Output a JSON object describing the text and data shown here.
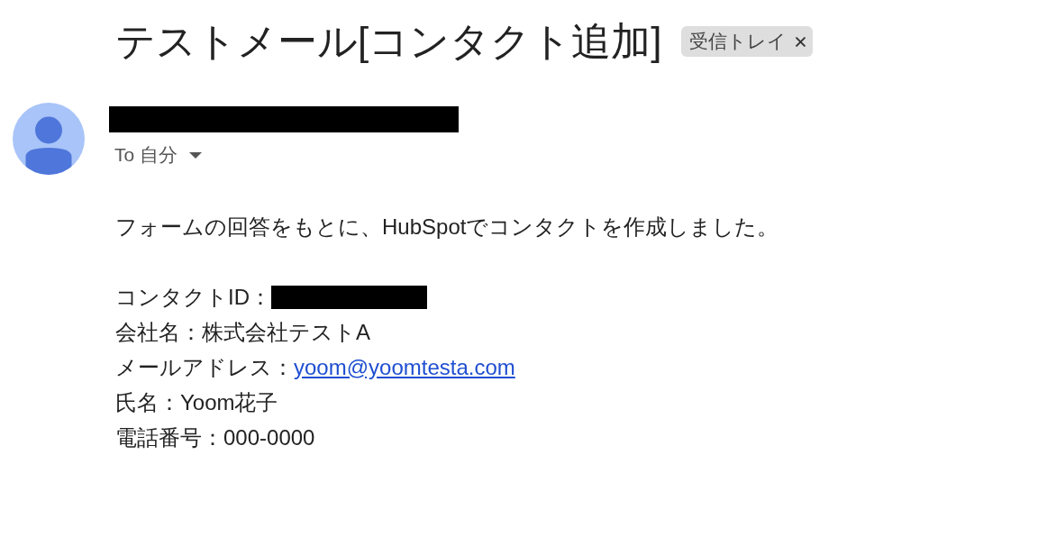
{
  "subject": {
    "title": "テストメール[コンタクト追加]",
    "labels": [
      {
        "text": "受信トレイ"
      }
    ]
  },
  "message": {
    "sender": {
      "redacted": true
    },
    "recipient": "To 自分",
    "body": {
      "intro": "フォームの回答をもとに、HubSpotでコンタクトを作成しました。",
      "fields": [
        {
          "kind": "redacted",
          "label": "コンタクトID："
        },
        {
          "kind": "text",
          "label": "会社名：",
          "value": "株式会社テストA"
        },
        {
          "kind": "link",
          "label": "メールアドレス：",
          "value": "yoom@yoomtesta.com"
        },
        {
          "kind": "text",
          "label": "氏名：",
          "value": "Yoom花子"
        },
        {
          "kind": "text",
          "label": "電話番号：",
          "value": "000-0000"
        }
      ]
    }
  }
}
